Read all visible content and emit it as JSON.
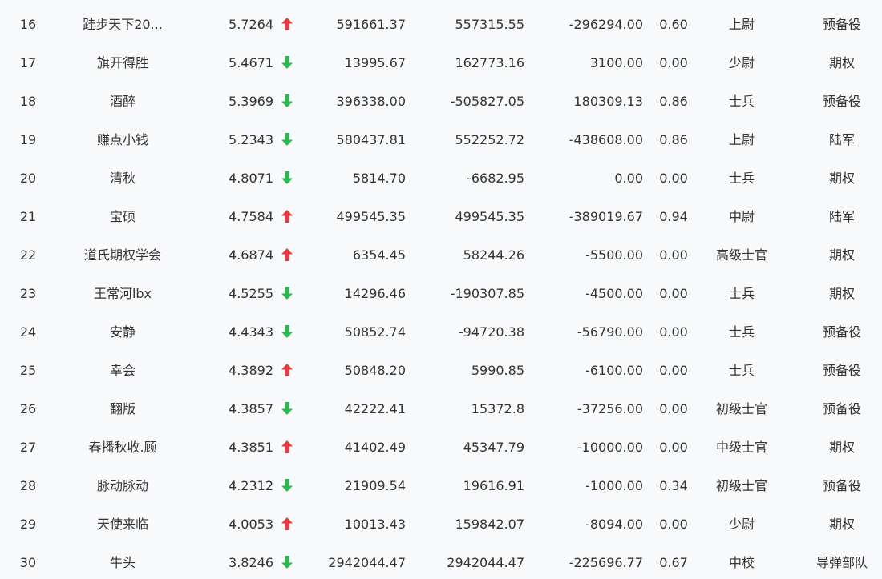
{
  "colors": {
    "up": "#e83c3c",
    "down": "#2db84d",
    "text": "#333333",
    "background": "#f8f9fb"
  },
  "rows": [
    {
      "rank": "16",
      "name": "跬步天下20...",
      "score": "5.7264",
      "trend": "up",
      "value1": "591661.37",
      "value2": "557315.55",
      "value3": "-296294.00",
      "ratio": "0.60",
      "rank_title": "上尉",
      "type": "预备役"
    },
    {
      "rank": "17",
      "name": "旗开得胜",
      "score": "5.4671",
      "trend": "down",
      "value1": "13995.67",
      "value2": "162773.16",
      "value3": "3100.00",
      "ratio": "0.00",
      "rank_title": "少尉",
      "type": "期权"
    },
    {
      "rank": "18",
      "name": "酒醉",
      "score": "5.3969",
      "trend": "down",
      "value1": "396338.00",
      "value2": "-505827.05",
      "value3": "180309.13",
      "ratio": "0.86",
      "rank_title": "士兵",
      "type": "预备役"
    },
    {
      "rank": "19",
      "name": "赚点小钱",
      "score": "5.2343",
      "trend": "down",
      "value1": "580437.81",
      "value2": "552252.72",
      "value3": "-438608.00",
      "ratio": "0.86",
      "rank_title": "上尉",
      "type": "陆军"
    },
    {
      "rank": "20",
      "name": "清秋",
      "score": "4.8071",
      "trend": "down",
      "value1": "5814.70",
      "value2": "-6682.95",
      "value3": "0.00",
      "ratio": "0.00",
      "rank_title": "士兵",
      "type": "期权"
    },
    {
      "rank": "21",
      "name": "宝硕",
      "score": "4.7584",
      "trend": "up",
      "value1": "499545.35",
      "value2": "499545.35",
      "value3": "-389019.67",
      "ratio": "0.94",
      "rank_title": "中尉",
      "type": "陆军"
    },
    {
      "rank": "22",
      "name": "道氏期权学会",
      "score": "4.6874",
      "trend": "up",
      "value1": "6354.45",
      "value2": "58244.26",
      "value3": "-5500.00",
      "ratio": "0.00",
      "rank_title": "高级士官",
      "type": "期权"
    },
    {
      "rank": "23",
      "name": "王常河lbx",
      "score": "4.5255",
      "trend": "down",
      "value1": "14296.46",
      "value2": "-190307.85",
      "value3": "-4500.00",
      "ratio": "0.00",
      "rank_title": "士兵",
      "type": "期权"
    },
    {
      "rank": "24",
      "name": "安静",
      "score": "4.4343",
      "trend": "down",
      "value1": "50852.74",
      "value2": "-94720.38",
      "value3": "-56790.00",
      "ratio": "0.00",
      "rank_title": "士兵",
      "type": "预备役"
    },
    {
      "rank": "25",
      "name": "幸会",
      "score": "4.3892",
      "trend": "up",
      "value1": "50848.20",
      "value2": "5990.85",
      "value3": "-6100.00",
      "ratio": "0.00",
      "rank_title": "士兵",
      "type": "预备役"
    },
    {
      "rank": "26",
      "name": "翻版",
      "score": "4.3857",
      "trend": "down",
      "value1": "42222.41",
      "value2": "15372.8",
      "value3": "-37256.00",
      "ratio": "0.00",
      "rank_title": "初级士官",
      "type": "预备役"
    },
    {
      "rank": "27",
      "name": "春播秋收.顾",
      "score": "4.3851",
      "trend": "up",
      "value1": "41402.49",
      "value2": "45347.79",
      "value3": "-10000.00",
      "ratio": "0.00",
      "rank_title": "中级士官",
      "type": "期权"
    },
    {
      "rank": "28",
      "name": "脉动脉动",
      "score": "4.2312",
      "trend": "down",
      "value1": "21909.54",
      "value2": "19616.91",
      "value3": "-1000.00",
      "ratio": "0.34",
      "rank_title": "初级士官",
      "type": "预备役"
    },
    {
      "rank": "29",
      "name": "天使来临",
      "score": "4.0053",
      "trend": "up",
      "value1": "10013.43",
      "value2": "159842.07",
      "value3": "-8094.00",
      "ratio": "0.00",
      "rank_title": "少尉",
      "type": "期权"
    },
    {
      "rank": "30",
      "name": "牛头",
      "score": "3.8246",
      "trend": "down",
      "value1": "2942044.47",
      "value2": "2942044.47",
      "value3": "-225696.77",
      "ratio": "0.67",
      "rank_title": "中校",
      "type": "导弹部队"
    }
  ]
}
